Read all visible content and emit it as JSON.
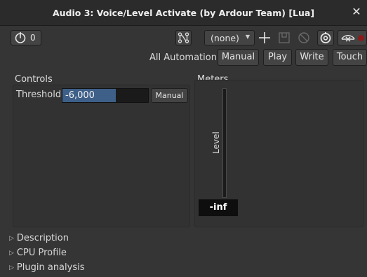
{
  "window": {
    "title": "Audio 3: Voice/Level Activate (by Ardour Team) [Lua]",
    "close_glyph": "✕"
  },
  "toolbar": {
    "latency_value": "0",
    "preset_value": "(none)",
    "preset_icon": "caret-down-icon",
    "add_icon": "plus-icon",
    "save_icon": "save-icon",
    "delete_icon": "no-entry-icon",
    "bypass_icon": "bypass-icon",
    "pin_icon": "pin-icon",
    "routing_icon": "routing-icon"
  },
  "automation": {
    "label": "All Automation",
    "buttons": [
      "Manual",
      "Play",
      "Write",
      "Touch"
    ]
  },
  "controls": {
    "section_label": "Controls",
    "threshold_label": "Threshold",
    "threshold_value": "-6,000",
    "threshold_fill": 0.62,
    "mode_button": "Manual"
  },
  "meters": {
    "section_label": "Meters",
    "level_label": "Level",
    "readout": "-inf"
  },
  "expanders": [
    {
      "label": "Description"
    },
    {
      "label": "CPU Profile"
    },
    {
      "label": "Plugin analysis"
    }
  ],
  "colors": {
    "slider_fill": "#3e5f88",
    "record_red": "#8a1b1b"
  }
}
